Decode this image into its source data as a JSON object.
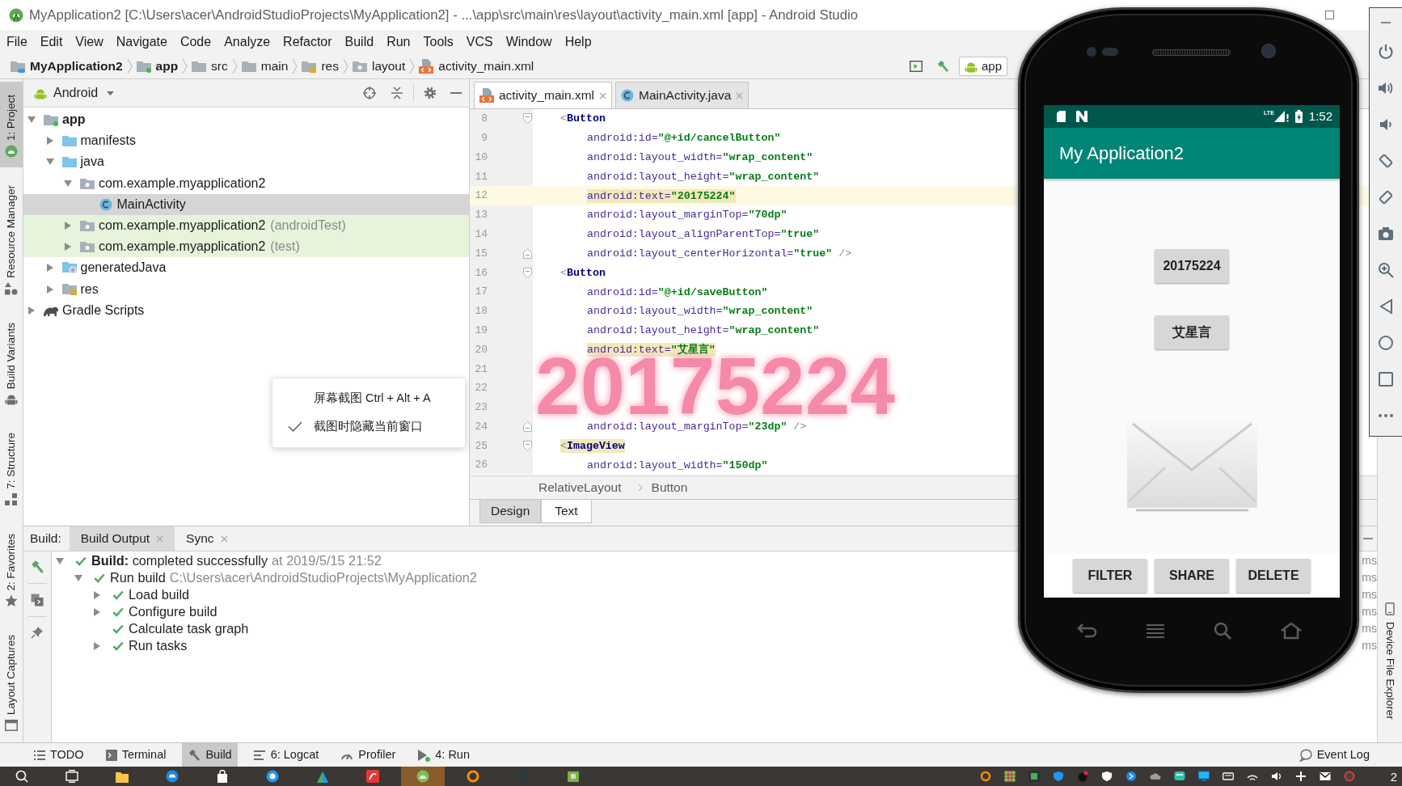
{
  "window": {
    "title": "MyApplication2 [C:\\Users\\acer\\AndroidStudioProjects\\MyApplication2] - ...\\app\\src\\main\\res\\layout\\activity_main.xml [app] - Android Studio"
  },
  "menu_bar": [
    "File",
    "Edit",
    "View",
    "Navigate",
    "Code",
    "Analyze",
    "Refactor",
    "Build",
    "Run",
    "Tools",
    "VCS",
    "Window",
    "Help"
  ],
  "nav_bar": {
    "path": [
      {
        "label": "MyApplication2",
        "kind": "project"
      },
      {
        "label": "app",
        "kind": "module"
      },
      {
        "label": "src",
        "kind": "folder"
      },
      {
        "label": "main",
        "kind": "folder"
      },
      {
        "label": "res",
        "kind": "res"
      },
      {
        "label": "layout",
        "kind": "package"
      },
      {
        "label": "activity_main.xml",
        "kind": "xml"
      }
    ],
    "run_config": "app"
  },
  "left_tool_strip": [
    {
      "label": "1: Project",
      "selected": true
    },
    {
      "label": "Resource Manager",
      "selected": false
    },
    {
      "label": "Build Variants",
      "selected": false
    },
    {
      "label": "7: Structure",
      "selected": false
    },
    {
      "label": "2: Favorites",
      "selected": false
    },
    {
      "label": "Layout Captures",
      "selected": false
    }
  ],
  "project_panel": {
    "view": "Android",
    "tree": [
      {
        "label": "app",
        "kind": "module",
        "expanded": true,
        "selected": false,
        "test_source": false,
        "children": [
          {
            "label": "manifests",
            "kind": "source_folder",
            "expanded": false,
            "selected": false,
            "test_source": false
          },
          {
            "label": "java",
            "kind": "source_folder",
            "expanded": true,
            "selected": false,
            "test_source": false,
            "children": [
              {
                "label": "com.example.myapplication2",
                "kind": "package",
                "expanded": true,
                "selected": false,
                "test_source": false,
                "children": [
                  {
                    "label": "MainActivity",
                    "kind": "class",
                    "selected": true,
                    "test_source": false
                  }
                ]
              },
              {
                "label": "com.example.myapplication2",
                "note": "(androidTest)",
                "kind": "package",
                "expanded": false,
                "selected": false,
                "test_source": true
              },
              {
                "label": "com.example.myapplication2",
                "note": "(test)",
                "kind": "package",
                "expanded": false,
                "selected": false,
                "test_source": true
              }
            ]
          },
          {
            "label": "generatedJava",
            "kind": "generated",
            "expanded": false,
            "selected": false,
            "test_source": false
          },
          {
            "label": "res",
            "kind": "res",
            "expanded": false,
            "selected": false,
            "test_source": false
          }
        ]
      },
      {
        "label": "Gradle Scripts",
        "kind": "gradle",
        "expanded": false,
        "selected": false,
        "test_source": false
      }
    ]
  },
  "screenshot_menu": {
    "items": [
      {
        "label": "屏幕截图 Ctrl + Alt + A",
        "checked": false
      },
      {
        "label": "截图时隐藏当前窗口",
        "checked": true
      }
    ]
  },
  "editor": {
    "tabs": [
      {
        "label": "activity_main.xml",
        "kind": "xml",
        "selected": true
      },
      {
        "label": "MainActivity.java",
        "kind": "class",
        "selected": false
      }
    ],
    "lines": [
      {
        "number": "8",
        "kind": "tag",
        "bracket": "<",
        "tag": "Button",
        "fold_start": true,
        "fold_end": false,
        "current": false,
        "highlighted": false
      },
      {
        "number": "9",
        "kind": "attribute",
        "attr": "android:id=",
        "value": "\"@+id/cancelButton\"",
        "fold_start": false,
        "fold_end": false,
        "current": false,
        "highlighted": false
      },
      {
        "number": "10",
        "kind": "attribute",
        "attr": "android:layout_width=",
        "value": "\"wrap_content\"",
        "fold_start": false,
        "fold_end": false,
        "current": false,
        "highlighted": false
      },
      {
        "number": "11",
        "kind": "attribute",
        "attr": "android:layout_height=",
        "value": "\"wrap_content\"",
        "fold_start": false,
        "fold_end": false,
        "current": false,
        "highlighted": false
      },
      {
        "number": "12",
        "kind": "attribute",
        "attr": "android:text=",
        "value": "\"20175224\"",
        "fold_start": false,
        "fold_end": false,
        "current": true,
        "highlighted": true
      },
      {
        "number": "13",
        "kind": "attribute",
        "attr": "android:layout_marginTop=",
        "value": "\"70dp\"",
        "fold_start": false,
        "fold_end": false,
        "current": false,
        "highlighted": false
      },
      {
        "number": "14",
        "kind": "attribute",
        "attr": "android:layout_alignParentTop=",
        "value": "\"true\"",
        "fold_start": false,
        "fold_end": false,
        "current": false,
        "highlighted": false
      },
      {
        "number": "15",
        "kind": "attribute",
        "attr": "android:layout_centerHorizontal=",
        "value": "\"true\"",
        "tail": " />",
        "fold_start": false,
        "fold_end": true,
        "current": false,
        "highlighted": false
      },
      {
        "number": "16",
        "kind": "tag",
        "bracket": "<",
        "tag": "Button",
        "fold_start": true,
        "fold_end": false,
        "current": false,
        "highlighted": false
      },
      {
        "number": "17",
        "kind": "attribute",
        "attr": "android:id=",
        "value": "\"@+id/saveButton\"",
        "fold_start": false,
        "fold_end": false,
        "current": false,
        "highlighted": false
      },
      {
        "number": "18",
        "kind": "attribute",
        "attr": "android:layout_width=",
        "value": "\"wrap_content\"",
        "fold_start": false,
        "fold_end": false,
        "current": false,
        "highlighted": false
      },
      {
        "number": "19",
        "kind": "attribute",
        "attr": "android:layout_height=",
        "value": "\"wrap_content\"",
        "fold_start": false,
        "fold_end": false,
        "current": false,
        "highlighted": false
      },
      {
        "number": "20",
        "kind": "attribute",
        "attr": "android:text=",
        "value": "\"艾星言\"",
        "fold_start": false,
        "fold_end": false,
        "current": false,
        "highlighted": true
      },
      {
        "number": "21",
        "kind": "covered",
        "fold_start": false,
        "fold_end": false,
        "current": false
      },
      {
        "number": "22",
        "kind": "covered",
        "fold_start": false,
        "fold_end": false,
        "current": false
      },
      {
        "number": "23",
        "kind": "covered",
        "fold_start": false,
        "fold_end": false,
        "current": false
      },
      {
        "number": "24",
        "kind": "attribute",
        "attr": "android:layout_marginTop=",
        "value": "\"23dp\"",
        "tail": " />",
        "fold_start": false,
        "fold_end": true,
        "current": false,
        "highlighted": false
      },
      {
        "number": "25",
        "kind": "tag",
        "bracket": "<",
        "tag": "ImageView",
        "fold_start": true,
        "fold_end": false,
        "current": false,
        "highlighted": true
      },
      {
        "number": "26",
        "kind": "attribute",
        "attr": "android:layout_width=",
        "value": "\"150dp\"",
        "fold_start": false,
        "fold_end": false,
        "current": false,
        "highlighted": false
      }
    ],
    "overlay_label": "20175224",
    "breadcrumb": [
      "RelativeLayout",
      "Button"
    ],
    "mode_tabs": [
      {
        "label": "Design",
        "selected": false
      },
      {
        "label": "Text",
        "selected": true
      }
    ]
  },
  "build_panel": {
    "title": "Build:",
    "tabs": [
      {
        "label": "Build Output",
        "selected": true
      },
      {
        "label": "Sync",
        "selected": false
      }
    ],
    "tree": [
      {
        "label": "**Build:** completed successfully",
        "note": "at 2019/5/15 21:52",
        "done": true,
        "time": "ms",
        "expanded": true,
        "children": [
          {
            "label": "Run build",
            "note": "C:\\Users\\acer\\AndroidStudioProjects\\MyApplication2",
            "done": true,
            "time": "ms",
            "expanded": true,
            "children": [
              {
                "label": "Load build",
                "done": true,
                "time": "ms",
                "expanded": false
              },
              {
                "label": "Configure build",
                "done": true,
                "time": "ms",
                "expanded": false
              },
              {
                "label": "Calculate task graph",
                "done": true,
                "time": "ms"
              },
              {
                "label": "Run tasks",
                "done": true,
                "time": "ms",
                "expanded": false
              }
            ]
          }
        ]
      }
    ]
  },
  "bottom_toolbar": {
    "left": [
      {
        "label": "TODO",
        "selected": false
      },
      {
        "label": "Terminal",
        "selected": false
      },
      {
        "label": "Build",
        "selected": true
      },
      {
        "label": "6: Logcat",
        "selected": false
      },
      {
        "label": "Profiler",
        "selected": false
      },
      {
        "label": "4: Run",
        "selected": false
      }
    ],
    "right": [
      {
        "label": "Event Log"
      }
    ]
  },
  "right_tool_strip": [
    {
      "label": "Device File Explorer"
    }
  ],
  "emulator": {
    "status_bar": {
      "network": "LTE",
      "time": "1:52"
    },
    "app_title": "My Application2",
    "buttons": [
      "20175224",
      "艾星言"
    ],
    "bottom_buttons": [
      "FILTER",
      "SHARE",
      "DELETE"
    ]
  },
  "taskbar": {
    "apps": [
      {
        "selected": false
      },
      {
        "selected": false
      },
      {
        "selected": false
      },
      {
        "selected": false
      },
      {
        "selected": false
      },
      {
        "selected": false
      },
      {
        "selected": false
      },
      {
        "selected": false
      },
      {
        "selected": true
      },
      {
        "selected": false
      },
      {
        "selected": false
      },
      {
        "selected": false
      }
    ],
    "clock": "2"
  }
}
